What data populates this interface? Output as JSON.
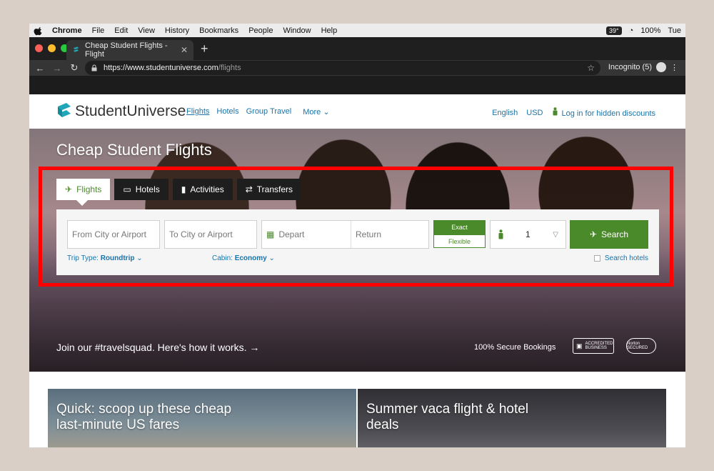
{
  "os_menubar": {
    "app": "Chrome",
    "items": [
      "File",
      "Edit",
      "View",
      "History",
      "Bookmarks",
      "People",
      "Window",
      "Help"
    ],
    "temp": "39°",
    "battery": "100%",
    "day": "Tue"
  },
  "browser": {
    "tab_title": "Cheap Student Flights - Flight",
    "url_host": "https://www.studentuniverse.com",
    "url_path": "/flights",
    "incognito_label": "Incognito (5)"
  },
  "site": {
    "brand": "StudentUniverse",
    "nav": [
      "Flights",
      "Hotels",
      "Group Travel",
      "More"
    ],
    "language": "English",
    "currency": "USD",
    "login": "Log in for hidden discounts"
  },
  "hero": {
    "title": "Cheap Student Flights",
    "tabs": [
      "Flights",
      "Hotels",
      "Activities",
      "Transfers"
    ],
    "from_placeholder": "From City or Airport",
    "to_placeholder": "To City or Airport",
    "depart_placeholder": "Depart",
    "return_placeholder": "Return",
    "exact_label": "Exact",
    "flexible_label": "Flexible",
    "passengers": "1",
    "search_label": "Search",
    "trip_type_label": "Trip Type:",
    "trip_type_value": "Roundtrip",
    "cabin_label": "Cabin:",
    "cabin_value": "Economy",
    "search_hotels": "Search hotels",
    "join_text": "Join our #travelsquad. Here's how it works.",
    "secure_text": "100% Secure Bookings",
    "bbb_text": "ACCREDITED BUSINESS",
    "norton_text": "Norton SECURED"
  },
  "cards": [
    {
      "title_line1": "Quick: scoop up these cheap",
      "title_line2": "last-minute US fares"
    },
    {
      "title_line1": "Summer vaca flight & hotel",
      "title_line2": "deals"
    }
  ],
  "colors": {
    "brand_green": "#4b8a2a",
    "link_blue": "#1a73a8",
    "highlight_red": "#ff0000"
  }
}
